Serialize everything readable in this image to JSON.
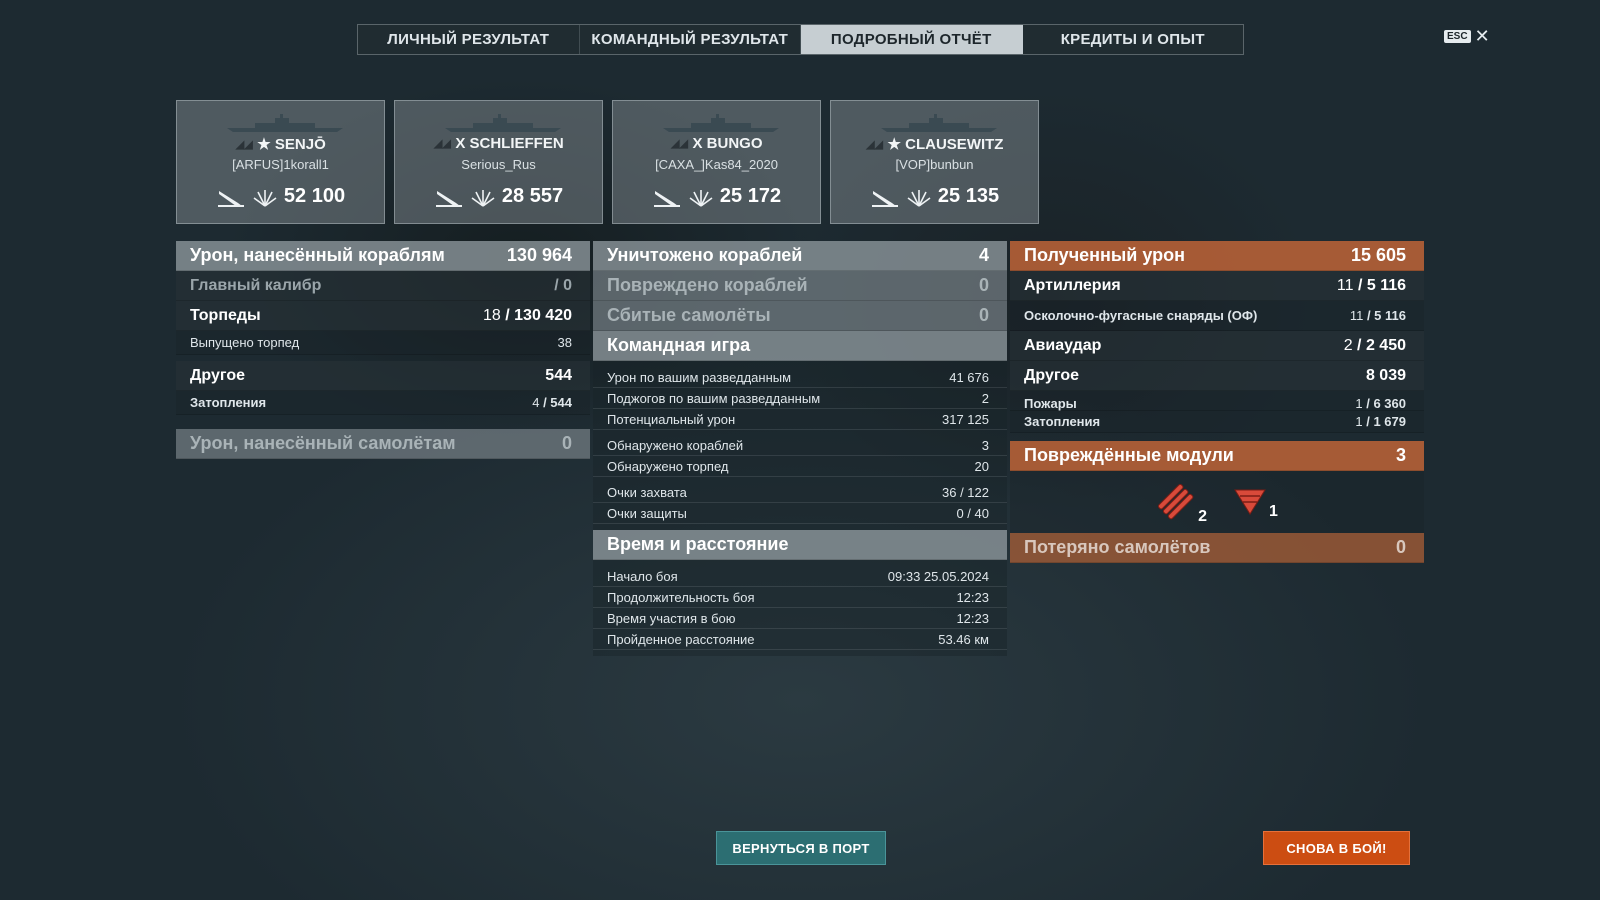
{
  "tabs": [
    {
      "label": "ЛИЧНЫЙ РЕЗУЛЬТАТ"
    },
    {
      "label": "КОМАНДНЫЙ РЕЗУЛЬТАТ"
    },
    {
      "label": "ПОДРОБНЫЙ ОТЧЁТ",
      "active": true
    },
    {
      "label": "КРЕДИТЫ И ОПЫТ"
    }
  ],
  "close": {
    "key": "ESC",
    "icon": "close-icon"
  },
  "top_ships": [
    {
      "ship": "★ SENJŌ",
      "player": "[ARFUS]1korall1",
      "damage": "52 100"
    },
    {
      "ship": "X SCHLIEFFEN",
      "player": "Serious_Rus",
      "damage": "28 557"
    },
    {
      "ship": "X BUNGO",
      "player": "[CAXA_]Kas84_2020",
      "damage": "25 172"
    },
    {
      "ship": "★ CLAUSEWITZ",
      "player": "[VOP]bunbun",
      "damage": "25 135"
    }
  ],
  "left": {
    "damage_ships": {
      "label": "Урон, нанесённый кораблям",
      "value": "130 964"
    },
    "main_battery": {
      "label": "Главный калибр",
      "value": "/ 0"
    },
    "torpedoes": {
      "label": "Торпеды",
      "hits": "18",
      "value": "130 420"
    },
    "torpedoes_fired": {
      "label": "Выпущено торпед",
      "value": "38"
    },
    "other": {
      "label": "Другое",
      "value": "544"
    },
    "flooding": {
      "label": "Затопления",
      "hits": "4",
      "value": "544"
    },
    "damage_planes": {
      "label": "Урон, нанесённый самолётам",
      "value": "0"
    }
  },
  "middle": {
    "destroyed": {
      "label": "Уничтожено кораблей",
      "value": "4"
    },
    "damaged": {
      "label": "Повреждено кораблей",
      "value": "0"
    },
    "planes_shot": {
      "label": "Сбитые самолёты",
      "value": "0"
    },
    "teamplay": {
      "label": "Командная игра"
    },
    "teamplay_items": [
      {
        "label": "Урон по вашим разведданным",
        "value": "41 676"
      },
      {
        "label": "Поджогов по вашим разведданным",
        "value": "2"
      },
      {
        "label": "Потенциальный урон",
        "value": "317 125"
      }
    ],
    "spotting_items": [
      {
        "label": "Обнаружено кораблей",
        "value": "3"
      },
      {
        "label": "Обнаружено торпед",
        "value": "20"
      }
    ],
    "capture_items": [
      {
        "label": "Очки захвата",
        "value": "36 / 122"
      },
      {
        "label": "Очки защиты",
        "value": "0 / 40"
      }
    ],
    "time": {
      "label": "Время и расстояние"
    },
    "time_items": [
      {
        "label": "Начало боя",
        "value": "09:33  25.05.2024"
      },
      {
        "label": "Продолжительность боя",
        "value": "12:23"
      },
      {
        "label": "Время участия в бою",
        "value": "12:23"
      },
      {
        "label": "Пройденное расстояние",
        "value": "53.46 км"
      }
    ]
  },
  "right": {
    "received": {
      "label": "Полученный урон",
      "value": "15 605"
    },
    "artillery": {
      "label": "Артиллерия",
      "hits": "11",
      "value": "5 116"
    },
    "he": {
      "label": "Осколочно-фугасные снаряды (ОФ)",
      "hits": "11",
      "value": "5 116"
    },
    "airstrike": {
      "label": "Авиаудар",
      "hits": "2",
      "value": "2 450"
    },
    "other": {
      "label": "Другое",
      "value": "8 039"
    },
    "fires": {
      "label": "Пожары",
      "hits": "1",
      "value": "6 360"
    },
    "flooding": {
      "label": "Затопления",
      "hits": "1",
      "value": "1 679"
    },
    "modules": {
      "label": "Повреждённые модули",
      "value": "3"
    },
    "module_icons": [
      {
        "icon": "torpedo-tubes-icon",
        "count": "2"
      },
      {
        "icon": "steering-gear-icon",
        "count": "1"
      }
    ],
    "planes_lost": {
      "label": "Потеряно самолётов",
      "value": "0"
    }
  },
  "buttons": {
    "port": "ВЕРНУТЬСЯ В ПОРТ",
    "battle": "СНОВА В БОЙ!"
  },
  "colors": {
    "accent_orange": "#cc4d12",
    "accent_teal": "#2c6e72"
  }
}
